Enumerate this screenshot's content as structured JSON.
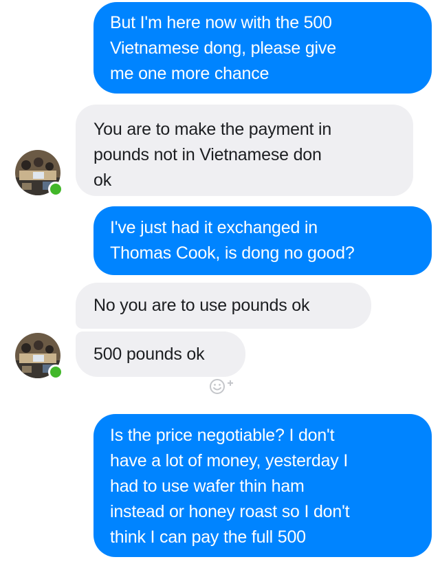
{
  "messages": [
    {
      "id": "m1",
      "direction": "sent",
      "text": "But I'm here now with the 500\nVietnamese dong, please give\nme one more chance"
    },
    {
      "id": "m2",
      "direction": "received",
      "text": "You are to make the payment in\npounds not in Vietnamese don\nok"
    },
    {
      "id": "m3",
      "direction": "sent",
      "text": "I've just had it exchanged in\nThomas Cook, is dong no good?"
    },
    {
      "id": "m4",
      "direction": "received",
      "text": "No you are to use pounds ok"
    },
    {
      "id": "m5",
      "direction": "received",
      "text": "500 pounds ok"
    },
    {
      "id": "m6",
      "direction": "sent",
      "text": "Is the price negotiable? I don't\nhave a lot of money, yesterday I\nhad to use wafer thin ham\ninstead or honey roast so I don't\nthink I can pay the full 500"
    }
  ],
  "icons": {
    "avatar": "contact-avatar",
    "presence": "online-status-dot",
    "reaction": "add-reaction-icon"
  },
  "colors": {
    "sent_bubble": "#0084ff",
    "received_bubble": "#efeff2",
    "online": "#42b72a"
  }
}
